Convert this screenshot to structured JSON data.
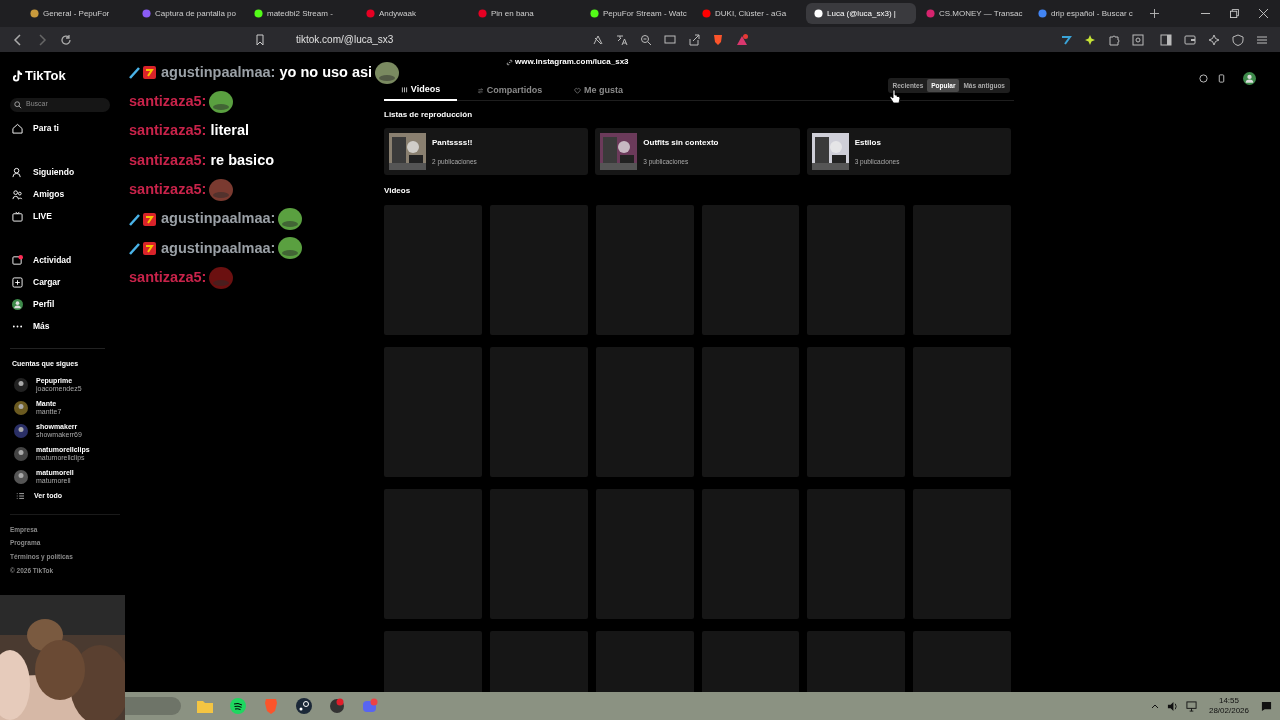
{
  "browser": {
    "tabs": [
      {
        "title": "General - PepuFor",
        "selected": false,
        "color": "#c89a3c"
      },
      {
        "title": "Captura de pantalla po",
        "selected": false,
        "color": "#8b5cf6"
      },
      {
        "title": "matedbi2 Stream -",
        "selected": false,
        "color": "#53fc18"
      },
      {
        "title": "Andywaak",
        "selected": false,
        "color": "#e60023"
      },
      {
        "title": "Pin en bana",
        "selected": false,
        "color": "#e60023"
      },
      {
        "title": "PepuFor Stream - Watc",
        "selected": false,
        "color": "#53fc18"
      },
      {
        "title": "DUKI, Clúster - aGa",
        "selected": false,
        "color": "#ff0000"
      },
      {
        "title": "Luca (@luca_sx3) |",
        "selected": true,
        "color": "#ffffff"
      },
      {
        "title": "CS.MONEY — Transac",
        "selected": false,
        "color": "#d6246e"
      },
      {
        "title": "drip español - Buscar c",
        "selected": false,
        "color": "#4285f4"
      }
    ],
    "address": "tiktok.com/@luca_sx3"
  },
  "chat": [
    {
      "user": "agustinpaalmaa:",
      "color": "#9aa0a6",
      "badges": true,
      "text": "yo no uso asi",
      "emote": true
    },
    {
      "user": "santizaza5:",
      "color": "#c8234a",
      "emote": true
    },
    {
      "user": "santizaza5:",
      "color": "#c8234a",
      "text": "literal"
    },
    {
      "user": "santizaza5:",
      "color": "#c8234a",
      "text": "re basico"
    },
    {
      "user": "santizaza5:",
      "color": "#c8234a",
      "emote": true
    },
    {
      "user": "agustinpaalmaa:",
      "color": "#9aa0a6",
      "badges": true,
      "emote": true
    },
    {
      "user": "agustinpaalmaa:",
      "color": "#9aa0a6",
      "badges": true,
      "emote": true
    },
    {
      "user": "santizaza5:",
      "color": "#c8234a",
      "emote": true
    }
  ],
  "sidebar": {
    "logo": "TikTok",
    "search": {
      "placeholder": "Buscar"
    },
    "nav": [
      {
        "label": "Para ti"
      },
      {
        "label": "Siguiendo"
      },
      {
        "label": "Amigos"
      },
      {
        "label": "LIVE"
      },
      {
        "label": "Actividad"
      },
      {
        "label": "Cargar"
      },
      {
        "label": "Perfil"
      },
      {
        "label": "Más"
      }
    ],
    "following_heading": "Cuentas que sigues",
    "accounts": [
      {
        "name": "Pepuprime",
        "handle": "joacomendez5"
      },
      {
        "name": "Mante",
        "handle": "mantte7"
      },
      {
        "name": "showmakerr",
        "handle": "showmakerr69"
      },
      {
        "name": "matumorellclips",
        "handle": "matumorellclips"
      },
      {
        "name": "matumorell",
        "handle": "matumorell"
      }
    ],
    "see_all": "Ver todo",
    "footer": [
      "Empresa",
      "Programa",
      "Términos y políticas",
      "© 2026 TikTok"
    ]
  },
  "profile": {
    "link": "www.instagram.com/luca_sx3",
    "tabs": [
      {
        "label": "Videos",
        "selected": true
      },
      {
        "label": "Compartidos",
        "selected": false
      },
      {
        "label": "Me gusta",
        "selected": false
      }
    ],
    "sort": [
      {
        "label": "Recientes",
        "selected": false
      },
      {
        "label": "Popular",
        "selected": true
      },
      {
        "label": "Más antiguos",
        "selected": false
      }
    ],
    "playlists_heading": "Listas de reproducción",
    "playlists": [
      {
        "title": "Pantssss!!",
        "count": "2 publicaciones"
      },
      {
        "title": "Outfits sin contexto",
        "count": "3 publicaciones"
      },
      {
        "title": "Estilos",
        "count": "3 publicaciones"
      }
    ],
    "videos_heading": "Videos"
  },
  "taskbar": {
    "time": "14:55",
    "date": "28/02/2026"
  }
}
